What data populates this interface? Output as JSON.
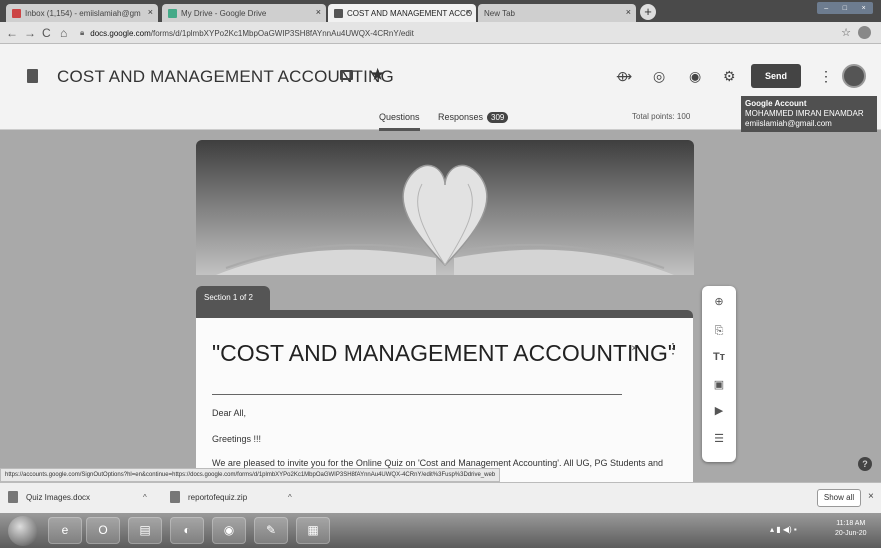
{
  "browser": {
    "tabs": [
      {
        "label": "Inbox (1,154) - emiislamiah@gm",
        "fav": "#c44"
      },
      {
        "label": "My Drive - Google Drive",
        "fav": "#4a8"
      },
      {
        "label": "COST AND MANAGEMENT ACCO",
        "fav": "#555"
      },
      {
        "label": "New Tab",
        "fav": ""
      }
    ],
    "url_domain": "docs.google.com",
    "url_path": "/forms/d/1plmbXYPo2Kc1MbpOaGWIP3SH8fAYnnAu4UWQX-4CRnY/edit",
    "status_url": "https://accounts.google.com/SignOutOptions?hl=en&continue=https://docs.google.com/forms/d/1plmbXYPo2Kc1MbpOaGWIP3SH8fAYnnAu4UWQX-4CRnY/edit%3Fusp%3Ddrive_web"
  },
  "header": {
    "title": "COST AND MANAGEMENT ACCOUNTING",
    "send_label": "Send",
    "tab_questions": "Questions",
    "tab_responses": "Responses",
    "responses_count": "309",
    "total_points": "Total points: 100",
    "account": {
      "heading": "Google Account",
      "name": "MOHAMMED IMRAN ENAMDAR",
      "email": "emiislamiah@gmail.com"
    }
  },
  "form": {
    "section_label": "Section 1 of 2",
    "title": "\"COST AND MANAGEMENT ACCOUNTING\"",
    "desc_line1": "Dear All,",
    "desc_line2": "Greetings !!!",
    "desc_line3": "We are pleased to invite you for the Online Quiz on 'Cost and Management Accounting'. All UG, PG Students and"
  },
  "downloads": {
    "items": [
      "Quiz Images.docx",
      "reportofequiz.zip"
    ],
    "show_all": "Show all"
  },
  "taskbar": {
    "time": "11:18 AM",
    "date": "20-Jun-20"
  }
}
